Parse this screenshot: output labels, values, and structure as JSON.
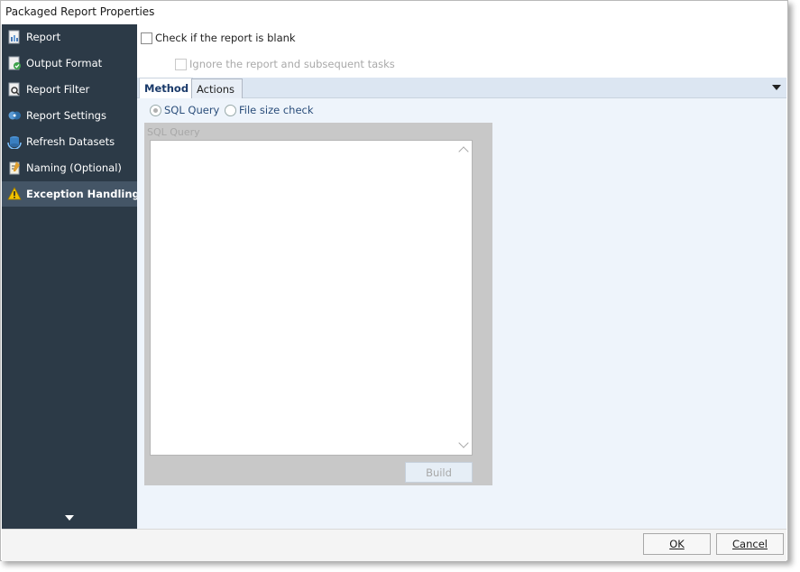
{
  "window": {
    "title": "Packaged Report Properties"
  },
  "sidebar": {
    "items": [
      {
        "label": "Report",
        "icon": "report-icon"
      },
      {
        "label": "Output Format",
        "icon": "output-format-icon"
      },
      {
        "label": "Report Filter",
        "icon": "filter-icon"
      },
      {
        "label": "Report Settings",
        "icon": "settings-icon"
      },
      {
        "label": "Refresh Datasets",
        "icon": "refresh-icon"
      },
      {
        "label": "Naming (Optional)",
        "icon": "naming-icon"
      },
      {
        "label": "Exception Handling",
        "icon": "warning-icon",
        "active": true
      }
    ]
  },
  "options": {
    "blank_check_label": "Check if the report is blank",
    "ignore_label": "Ignore the report and subsequent tasks"
  },
  "tabs": [
    {
      "label": "Method",
      "active": true
    },
    {
      "label": "Actions",
      "active": false
    }
  ],
  "method": {
    "sql_query_label": "SQL Query",
    "file_size_label": "File size check",
    "sql_box_label": "SQL Query",
    "build_label": "Build",
    "sql_text": ""
  },
  "footer": {
    "ok_label": "OK",
    "cancel_label": "Cancel"
  },
  "colors": {
    "sidebar_bg": "#2c3a47",
    "sidebar_active": "#445566",
    "panel_bg": "#eef4fb",
    "tabstrip_bg": "#dce6f2"
  }
}
